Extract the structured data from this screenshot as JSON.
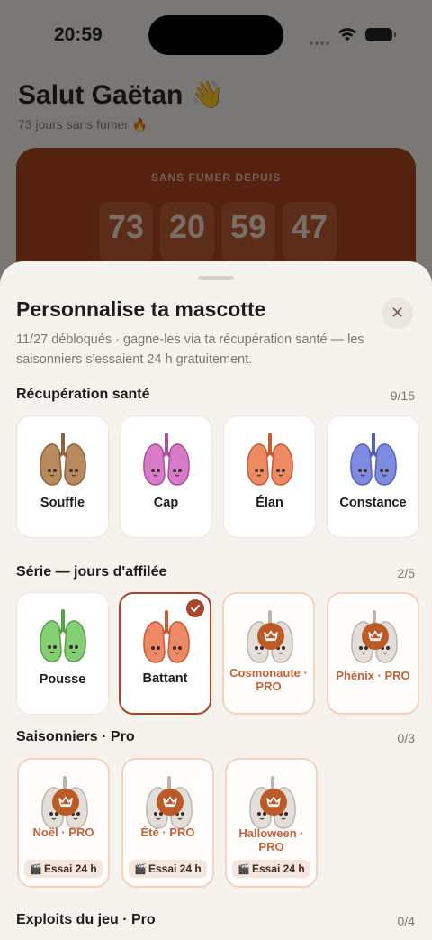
{
  "status_bar": {
    "time": "20:59"
  },
  "background": {
    "greeting": "Salut Gaëtan 👋",
    "subtitle": "73 jours sans fumer 🔥",
    "counter_label": "SANS FUMER DEPUIS",
    "counters": [
      "73",
      "20",
      "59",
      "47"
    ]
  },
  "sheet": {
    "title": "Personnalise ta mascotte",
    "subtitle": "11/27 débloqués · gagne-les via ta récupération santé — les saisonniers s'essaient 24 h gratuitement.",
    "close_label": "✕",
    "sections": [
      {
        "title": "Récupération santé",
        "count": "9/15",
        "items": [
          {
            "name": "Souffle",
            "color": "#b98a5e",
            "dark": "#8a6440",
            "locked": false,
            "selected": false
          },
          {
            "name": "Cap",
            "color": "#d77ac7",
            "dark": "#a8509a",
            "locked": false,
            "selected": false
          },
          {
            "name": "Élan",
            "color": "#ee8a62",
            "dark": "#c55d38",
            "locked": false,
            "selected": false
          },
          {
            "name": "Constance",
            "color": "#7f8be0",
            "dark": "#5662b5",
            "locked": false,
            "selected": false
          }
        ]
      },
      {
        "title": "Série — jours d'affilée",
        "count": "2/5",
        "items": [
          {
            "name": "Pousse",
            "color": "#84cf73",
            "dark": "#56a048",
            "locked": false,
            "selected": false
          },
          {
            "name": "Battant",
            "color": "#ef8864",
            "dark": "#c75b38",
            "locked": false,
            "selected": true
          },
          {
            "name": "Cosmonaute · PRO",
            "color": "#e3ded9",
            "dark": "#bdb6af",
            "locked": true,
            "selected": false
          },
          {
            "name": "Phénix · PRO",
            "color": "#e3ded9",
            "dark": "#bdb6af",
            "locked": true,
            "selected": false
          }
        ]
      },
      {
        "title": "Saisonniers · Pro",
        "count": "0/3",
        "items": [
          {
            "name": "Noël · PRO",
            "trial": "Essai 24 h",
            "color": "#e3ded9",
            "dark": "#bdb6af",
            "locked": true,
            "selected": false
          },
          {
            "name": "Été · PRO",
            "trial": "Essai 24 h",
            "color": "#e3ded9",
            "dark": "#bdb6af",
            "locked": true,
            "selected": false
          },
          {
            "name": "Halloween · PRO",
            "trial": "Essai 24 h",
            "color": "#e3ded9",
            "dark": "#bdb6af",
            "locked": true,
            "selected": false
          }
        ]
      },
      {
        "title": "Exploits du jeu · Pro",
        "count": "0/4",
        "items": []
      }
    ]
  },
  "icons": {
    "close": "close-icon",
    "crown": "crown-icon",
    "check": "check-icon",
    "clapper": "clapperboard-icon",
    "mascot": "lungs-mascot-icon"
  }
}
